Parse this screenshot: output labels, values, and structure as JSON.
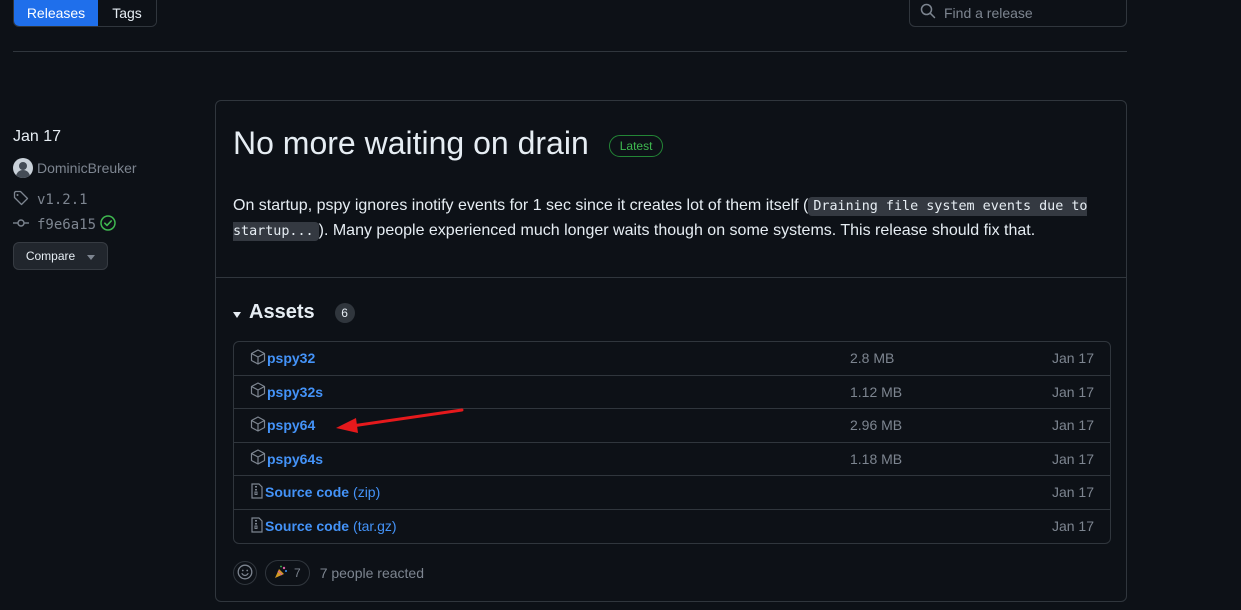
{
  "tabs": {
    "releases": "Releases",
    "tags": "Tags"
  },
  "search": {
    "placeholder": "Find a release"
  },
  "meta": {
    "date": "Jan 17",
    "author": "DominicBreuker",
    "tag": "v1.2.1",
    "commit": "f9e6a15",
    "compare_label": "Compare"
  },
  "release": {
    "title": "No more waiting on drain",
    "badge": "Latest",
    "desc_part1": "On startup, pspy ignores inotify events for 1 sec since it creates lot of them itself (",
    "desc_code": "Draining file system events due to startup...",
    "desc_part2": "). Many people experienced much longer waits though on some systems. This release should fix that."
  },
  "assets": {
    "title": "Assets",
    "count": "6",
    "items": [
      {
        "name": "pspy32",
        "sub": "",
        "size": "2.8 MB",
        "date": "Jan 17"
      },
      {
        "name": "pspy32s",
        "sub": "",
        "size": "1.12 MB",
        "date": "Jan 17"
      },
      {
        "name": "pspy64",
        "sub": "",
        "size": "2.96 MB",
        "date": "Jan 17"
      },
      {
        "name": "pspy64s",
        "sub": "",
        "size": "1.18 MB",
        "date": "Jan 17"
      },
      {
        "name": "Source code",
        "sub": "(zip)",
        "size": "",
        "date": "Jan 17"
      },
      {
        "name": "Source code",
        "sub": "(tar.gz)",
        "size": "",
        "date": "Jan 17"
      }
    ]
  },
  "reactions": {
    "count": "7",
    "text": "7 people reacted"
  },
  "colors": {
    "accent": "#1f6feb",
    "link": "#4493f8",
    "latest": "#3fb950",
    "arrow": "#e5191c"
  }
}
